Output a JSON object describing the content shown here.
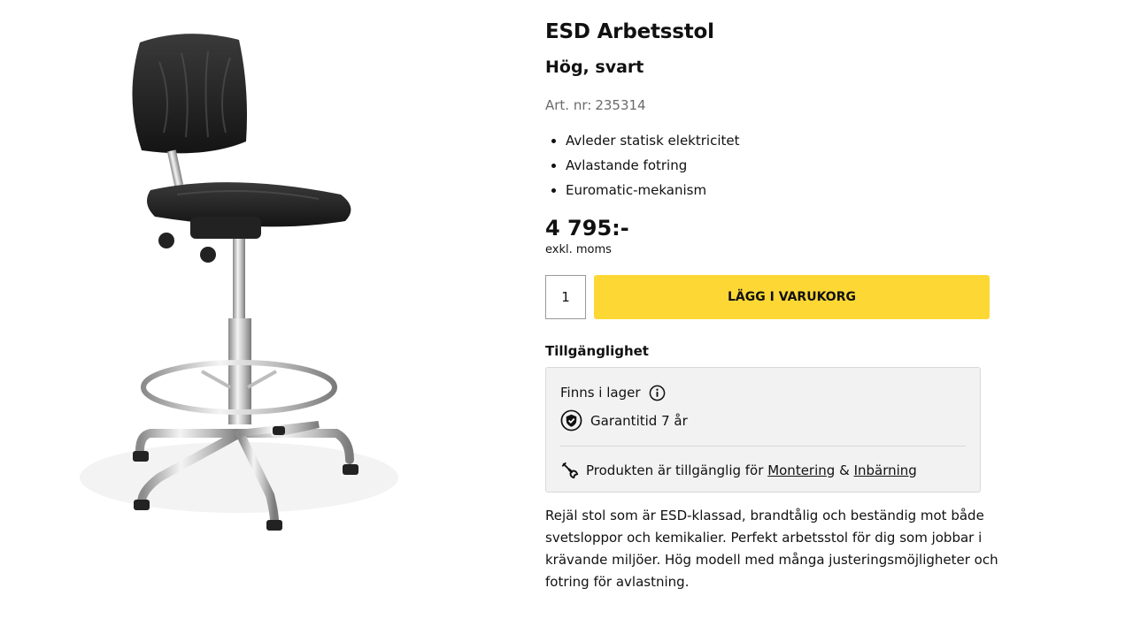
{
  "product": {
    "title": "ESD Arbetsstol",
    "subtitle": "Hög, svart",
    "art_label": "Art. nr:",
    "art_number": "235314",
    "features": [
      "Avleder statisk elektricitet",
      "Avlastande fotring",
      "Euromatic-mekanism"
    ],
    "price": "4 795:-",
    "vat_note": "exkl. moms",
    "image_icon": "office-chair-image",
    "description": "Rejäl stol som är ESD-klassad, brandtålig och beständig mot både svetsloppor och kemikalier. Perfekt arbetsstol för dig som jobbar i krävande miljöer. Hög modell med många justeringsmöjligheter och fotring för avlastning."
  },
  "cart": {
    "quantity": "1",
    "add_label": "LÄGG I VARUKORG",
    "button_color": "#fdd835"
  },
  "availability": {
    "title": "Tillgänglighet",
    "stock_text": "Finns i lager",
    "stock_icon": "info-icon",
    "warranty_text": "Garantitid 7 år",
    "warranty_icon": "shield-check-icon",
    "service_icon": "wrench-icon",
    "service_prefix": "Produkten är tillgänglig för",
    "service_link_1": "Montering",
    "service_and": "&",
    "service_link_2": "Inbärning"
  }
}
